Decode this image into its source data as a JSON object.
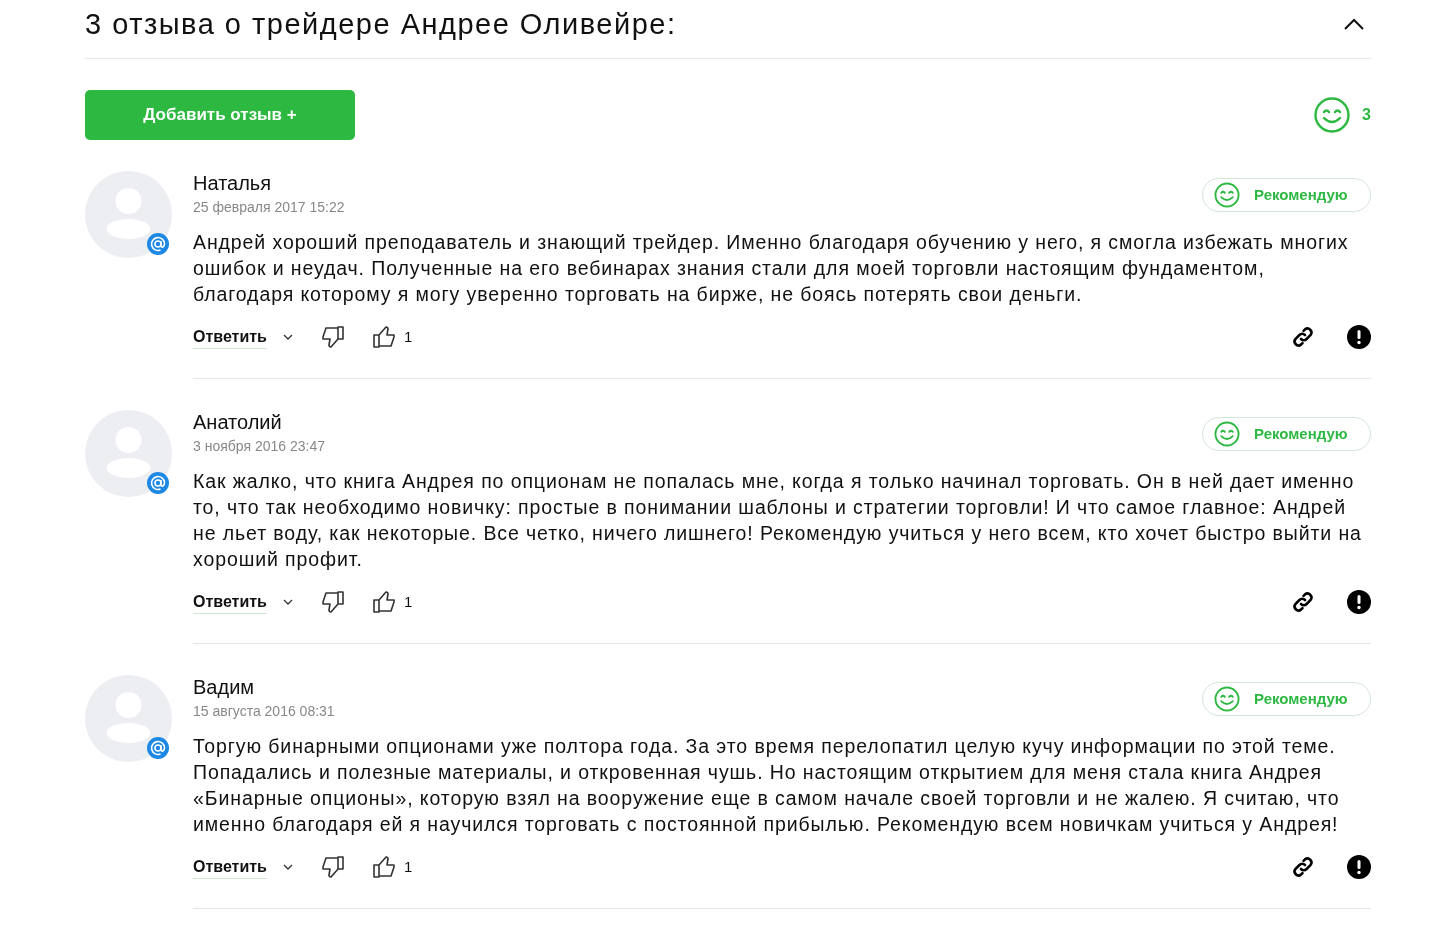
{
  "header": {
    "title": "3 отзыва о трейдере Андрее Оливейре:",
    "expanded": true
  },
  "add_button": "Добавить отзыв +",
  "recommend_count": "3",
  "reviews": [
    {
      "author": "Наталья",
      "date": "25 февраля 2017 15:22",
      "badge": "Рекомендую",
      "text": "Андрей хороший преподаватель и знающий трейдер. Именно благодаря обучению у него, я смогла избежать многих ошибок и неудач. Полученные на его вебинарах знания стали для моей торговли настоящим фундаментом, благодаря которому я могу уверенно торговать на бирже, не боясь потерять свои деньги.",
      "reply": "Ответить",
      "likes": "1"
    },
    {
      "author": "Анатолий",
      "date": "3 ноября 2016 23:47",
      "badge": "Рекомендую",
      "text": "Как жалко, что книга Андрея по опционам не попалась мне, когда я только начинал торговать. Он в ней дает именно то, что так необходимо новичку: простые в понимании шаблоны и стратегии торговли! И что самое главное: Андрей не льет воду, как некоторые. Все четко, ничего лишнего! Рекомендую учиться у него всем, кто хочет быстро выйти на хороший профит.",
      "reply": "Ответить",
      "likes": "1"
    },
    {
      "author": "Вадим",
      "date": "15 августа 2016 08:31",
      "badge": "Рекомендую",
      "text": "Торгую бинарными опционами уже полтора года. За это время перелопатил целую кучу информации по этой теме. Попадались и полезные материалы, и откровенная чушь. Но настоящим открытием для меня стала книга Андрея «Бинарные опционы», которую взял на вооружение еще в самом начале своей торговли и не жалею. Я считаю, что именно благодаря ей я научился торговать с постоянной прибылью. Рекомендую всем новичкам учиться у Андрея!",
      "reply": "Ответить",
      "likes": "1"
    }
  ]
}
